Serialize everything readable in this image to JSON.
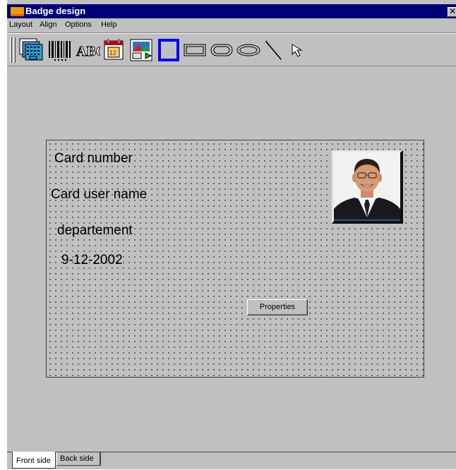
{
  "window": {
    "title": "Badge design",
    "close_glyph": "✕"
  },
  "menu": {
    "items": [
      "Layout",
      "Align",
      "Options",
      "Help"
    ]
  },
  "toolbar": {
    "tools": [
      {
        "name": "card-layers-icon"
      },
      {
        "name": "barcode-icon"
      },
      {
        "name": "text-abc-icon",
        "text": "ABC"
      },
      {
        "name": "date-calendar-icon"
      },
      {
        "name": "photo-image-icon"
      },
      {
        "name": "rectangle-tool-icon",
        "color": "#0000ff"
      },
      {
        "name": "rounded-rectangle-tool-icon"
      },
      {
        "name": "ellipse-tool-icon"
      },
      {
        "name": "line-tool-icon"
      },
      {
        "name": "pointer-arrow-icon"
      }
    ]
  },
  "badge": {
    "fields": {
      "card_number": "Card number",
      "card_user_name": "Card user name",
      "department": "departement",
      "date": "9-12-2002"
    },
    "properties_label": "Properties"
  },
  "tabs": [
    {
      "label": "Front side",
      "active": true
    },
    {
      "label": "Back side",
      "active": false
    }
  ],
  "colors": {
    "titlebar": "#00007b",
    "face": "#c0c0c0",
    "accent_blue": "#0000ff"
  }
}
